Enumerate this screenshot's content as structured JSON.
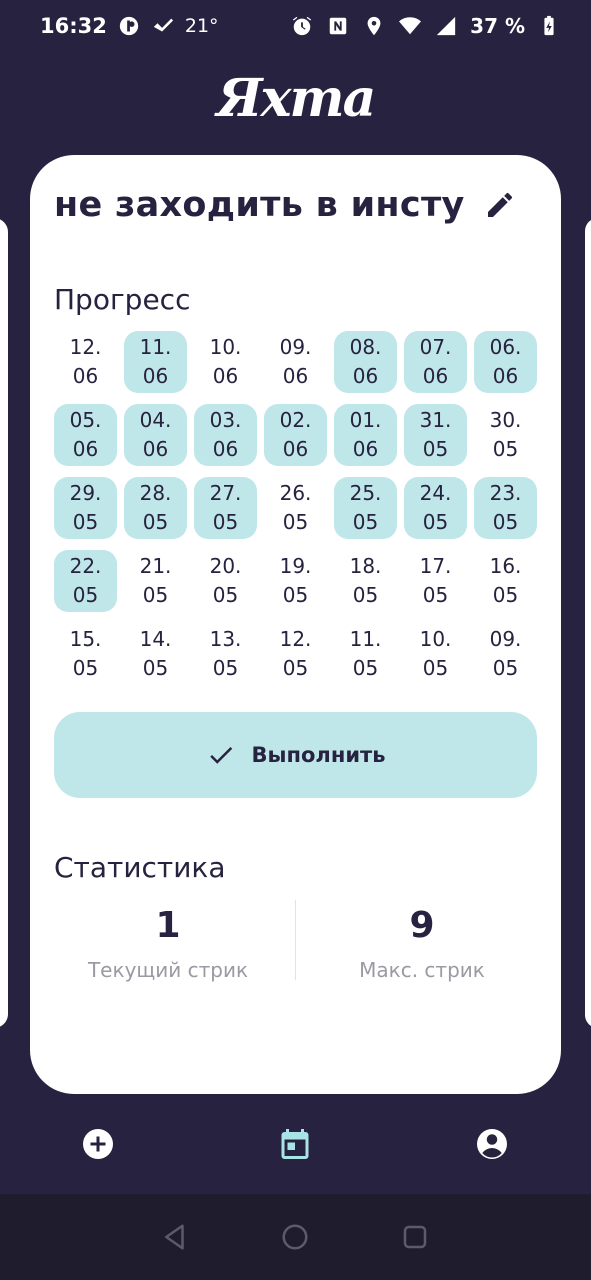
{
  "status_bar": {
    "time": "16:32",
    "temperature": "21°",
    "battery": "37 %",
    "left_icons": [
      "media-icon",
      "check-icon"
    ],
    "right_icons": [
      "alarm-icon",
      "nfc-icon",
      "location-icon",
      "wifi-icon",
      "signal-icon"
    ]
  },
  "app": {
    "logo": "Яхта"
  },
  "habit": {
    "title": "не заходить в инсту",
    "progress_title": "Прогресс",
    "days": [
      {
        "label": "12.\n06",
        "done": false
      },
      {
        "label": "11.\n06",
        "done": true
      },
      {
        "label": "10.\n06",
        "done": false
      },
      {
        "label": "09.\n06",
        "done": false
      },
      {
        "label": "08.\n06",
        "done": true
      },
      {
        "label": "07.\n06",
        "done": true
      },
      {
        "label": "06.\n06",
        "done": true
      },
      {
        "label": "05.\n06",
        "done": true
      },
      {
        "label": "04.\n06",
        "done": true
      },
      {
        "label": "03.\n06",
        "done": true
      },
      {
        "label": "02.\n06",
        "done": true
      },
      {
        "label": "01.\n06",
        "done": true
      },
      {
        "label": "31.\n05",
        "done": true
      },
      {
        "label": "30.\n05",
        "done": false
      },
      {
        "label": "29.\n05",
        "done": true
      },
      {
        "label": "28.\n05",
        "done": true
      },
      {
        "label": "27.\n05",
        "done": true
      },
      {
        "label": "26.\n05",
        "done": false
      },
      {
        "label": "25.\n05",
        "done": true
      },
      {
        "label": "24.\n05",
        "done": true
      },
      {
        "label": "23.\n05",
        "done": true
      },
      {
        "label": "22.\n05",
        "done": true
      },
      {
        "label": "21.\n05",
        "done": false
      },
      {
        "label": "20.\n05",
        "done": false
      },
      {
        "label": "19.\n05",
        "done": false
      },
      {
        "label": "18.\n05",
        "done": false
      },
      {
        "label": "17.\n05",
        "done": false
      },
      {
        "label": "16.\n05",
        "done": false
      },
      {
        "label": "15.\n05",
        "done": false
      },
      {
        "label": "14.\n05",
        "done": false
      },
      {
        "label": "13.\n05",
        "done": false
      },
      {
        "label": "12.\n05",
        "done": false
      },
      {
        "label": "11.\n05",
        "done": false
      },
      {
        "label": "10.\n05",
        "done": false
      },
      {
        "label": "09.\n05",
        "done": false
      }
    ],
    "complete_label": "Выполнить",
    "stats_title": "Статистика",
    "current_streak": {
      "value": "1",
      "label": "Текущий стрик"
    },
    "max_streak": {
      "value": "9",
      "label": "Макс. стрик"
    }
  },
  "bottom_nav": {
    "items": [
      "add-icon",
      "calendar-icon",
      "profile-icon"
    ],
    "active": "calendar-icon"
  },
  "colors": {
    "background": "#27223f",
    "card": "#ffffff",
    "accent": "#bfe6e8",
    "active_nav": "#a8e4e6",
    "text": "#27223f",
    "muted": "#9a9aa3"
  }
}
